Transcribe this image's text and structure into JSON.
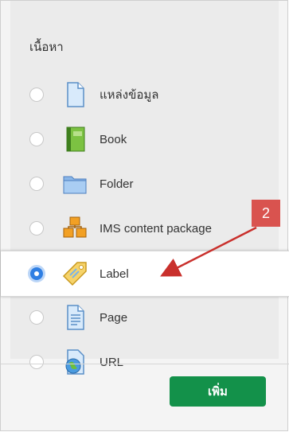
{
  "section_title": "เนื้อหา",
  "items": [
    {
      "label": "แหล่งข้อมูล",
      "icon": "file-icon",
      "selected": false
    },
    {
      "label": "Book",
      "icon": "book-icon",
      "selected": false
    },
    {
      "label": "Folder",
      "icon": "folder-icon",
      "selected": false
    },
    {
      "label": "IMS content package",
      "icon": "package-icon",
      "selected": false
    },
    {
      "label": "Label",
      "icon": "label-tag-icon",
      "selected": true
    },
    {
      "label": "Page",
      "icon": "page-icon",
      "selected": false
    },
    {
      "label": "URL",
      "icon": "url-globe-icon",
      "selected": false
    }
  ],
  "add_button_label": "เพิ่ม",
  "annotation": {
    "badge_text": "2",
    "color": "#d9534f"
  },
  "colors": {
    "selected_radio": "#2f7fe3",
    "add_button": "#13914a"
  }
}
